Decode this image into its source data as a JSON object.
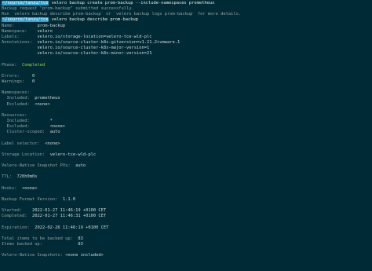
{
  "prompt": "~/source/tanzu/tce",
  "commands": [
    "velero backup create prom-backup --include-namespaces prometheus",
    "velero backup describe prom-backup"
  ],
  "create_output": [
    "Backup request \"prom-backup\" submitted successfully.",
    "Run `velero backup describe prom-backup` or `velero backup logs prom-backup` for more details."
  ],
  "describe": {
    "name_label": "Name:",
    "name_value": "prom-backup",
    "namespace_label": "Namespace:",
    "namespace_value": "velero",
    "labels_label": "Labels:",
    "labels_value": "velero.io/storage-location=velero-tce-wld-plc",
    "annotations_label": "Annotations:",
    "annotations": [
      "velero.io/source-cluster-k8s-gitversion=v1.21.2+vmware.1",
      "velero.io/source-cluster-k8s-major-version=1",
      "velero.io/source-cluster-k8s-minor-version=21"
    ],
    "phase_label": "Phase:",
    "phase_value": "Completed",
    "errors_label": "Errors:",
    "errors_value": "0",
    "warnings_label": "Warnings:",
    "warnings_value": "0",
    "namespaces_header": "Namespaces:",
    "ns_included_label": "Included:",
    "ns_included_value": "prometheus",
    "ns_excluded_label": "Excluded:",
    "ns_excluded_value": "<none>",
    "resources_header": "Resources:",
    "res_included_label": "Included:",
    "res_included_value": "*",
    "res_excluded_label": "Excluded:",
    "res_excluded_value": "<none>",
    "cluster_scoped_label": "Cluster-scoped:",
    "cluster_scoped_value": "auto",
    "label_selector_label": "Label selector:",
    "label_selector_value": "<none>",
    "storage_location_label": "Storage Location:",
    "storage_location_value": "velero-tce-wld-plc",
    "snapshot_pvs_label": "Velero-Native Snapshot PVs:",
    "snapshot_pvs_value": "auto",
    "ttl_label": "TTL:",
    "ttl_value": "720h0m0s",
    "hooks_label": "Hooks:",
    "hooks_value": "<none>",
    "backup_format_label": "Backup Format Version:",
    "backup_format_value": "1.1.0",
    "started_label": "Started:",
    "started_value": "2022-01-27 11:46:19 +0100 CET",
    "completed_label": "Completed:",
    "completed_value": "2022-01-27 11:46:31 +0100 CET",
    "expiration_label": "Expiration:",
    "expiration_value": "2022-02-26 11:46:19 +0100 CET",
    "total_items_label": "Total items to be backed up:",
    "total_items_value": "83",
    "items_backed_label": "Items backed up:",
    "items_backed_value": "83",
    "native_snapshots_label": "Velero-Native Snapshots:",
    "native_snapshots_value": "<none included>"
  }
}
